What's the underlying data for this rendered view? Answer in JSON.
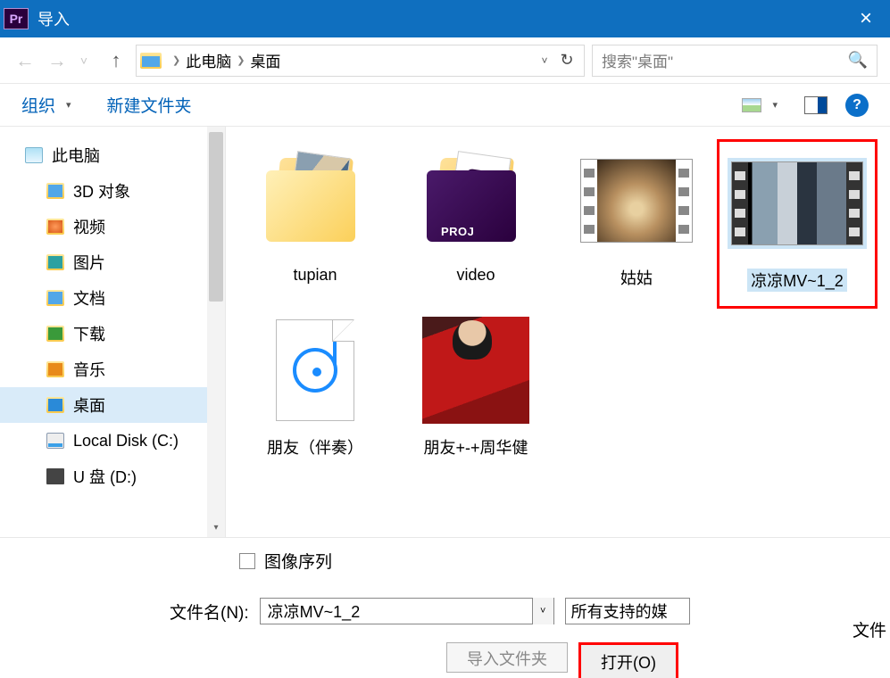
{
  "titlebar": {
    "app_abbr": "Pr",
    "title": "导入"
  },
  "nav": {
    "path": [
      "此电脑",
      "桌面"
    ],
    "search_placeholder": "搜索\"桌面\""
  },
  "toolbar": {
    "organize": "组织",
    "new_folder": "新建文件夹",
    "help_glyph": "?"
  },
  "sidebar": {
    "root": "此电脑",
    "items": [
      {
        "label": "3D 对象",
        "icon": "blue"
      },
      {
        "label": "视频",
        "icon": "red"
      },
      {
        "label": "图片",
        "icon": "teal"
      },
      {
        "label": "文档",
        "icon": "blue"
      },
      {
        "label": "下载",
        "icon": "down"
      },
      {
        "label": "音乐",
        "icon": "mus"
      },
      {
        "label": "桌面",
        "icon": "desk",
        "selected": true
      },
      {
        "label": "Local Disk (C:)",
        "icon": "disk"
      },
      {
        "label": "U 盘 (D:)",
        "icon": "udisk"
      }
    ]
  },
  "items": [
    {
      "name": "tupian",
      "kind": "folder-img"
    },
    {
      "name": "video",
      "kind": "folder-pr"
    },
    {
      "name": "姑姑",
      "kind": "clip1"
    },
    {
      "name": "凉凉MV~1_2",
      "kind": "clip2",
      "selected": true
    },
    {
      "name": "朋友（伴奏）",
      "kind": "audio-page"
    },
    {
      "name": "朋友+-+周华健",
      "kind": "photo"
    }
  ],
  "bottom": {
    "image_sequence": "图像序列",
    "filename_label": "文件名(N):",
    "filename_value": "凉凉MV~1_2",
    "filter_value": "所有支持的媒",
    "truncated_right": "文件",
    "import_folder": "导入文件夹",
    "open": "打开(O)"
  }
}
